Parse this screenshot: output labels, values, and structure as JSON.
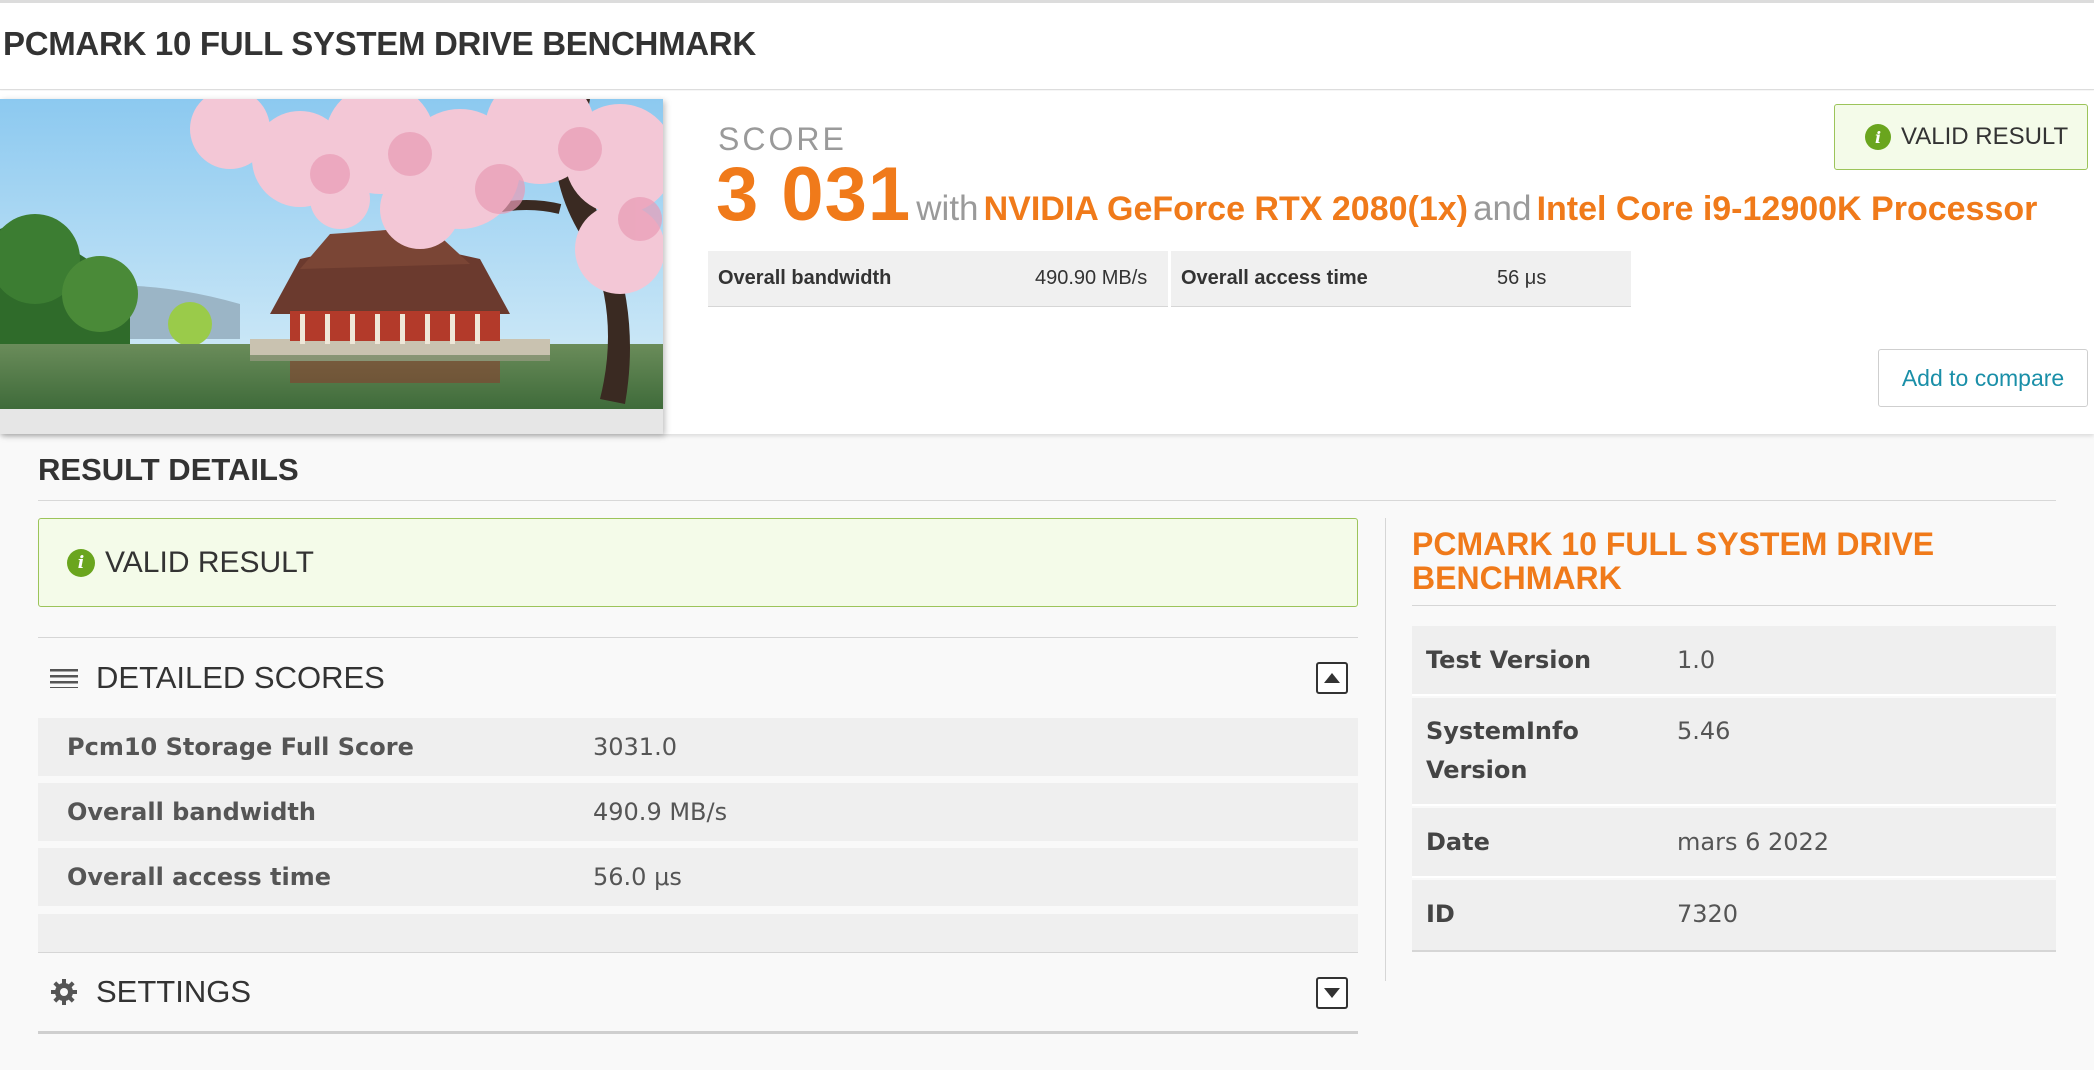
{
  "header": {
    "title": "PCMARK 10 FULL SYSTEM DRIVE BENCHMARK"
  },
  "score_panel": {
    "label": "SCORE",
    "value": "3 031",
    "with_text": "with",
    "gpu": "NVIDIA GeForce RTX 2080(1x)",
    "and_text": "and",
    "cpu": "Intel Core i9-12900K Processor",
    "valid_label": "VALID RESULT",
    "stats": [
      {
        "name": "Overall bandwidth",
        "value": "490.90 MB/s"
      },
      {
        "name": "Overall access time",
        "value": "56 μs"
      }
    ],
    "compare_button": "Add to compare"
  },
  "result_details": {
    "title": "RESULT DETAILS",
    "valid_label": "VALID RESULT",
    "detailed_scores": {
      "title": "DETAILED SCORES",
      "rows": [
        {
          "name": "Pcm10 Storage Full Score",
          "value": "3031.0"
        },
        {
          "name": "Overall bandwidth",
          "value": "490.9 MB/s"
        },
        {
          "name": "Overall access time",
          "value": "56.0 μs"
        }
      ]
    },
    "settings": {
      "title": "SETTINGS"
    }
  },
  "benchmark_info": {
    "title": "PCMARK 10 FULL SYSTEM DRIVE BENCHMARK",
    "rows": [
      {
        "name": "Test Version",
        "value": "1.0"
      },
      {
        "name": "SystemInfo Version",
        "value": "5.46"
      },
      {
        "name": "Date",
        "value": "mars 6 2022"
      },
      {
        "name": "ID",
        "value": "7320"
      }
    ]
  },
  "colors": {
    "accent": "#f07a1a",
    "valid_green": "#6aa51e",
    "link": "#1a8fa8"
  }
}
